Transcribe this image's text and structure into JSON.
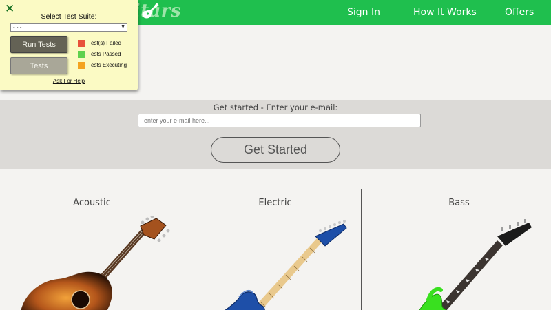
{
  "header": {
    "logo_text": "Original Guitars",
    "logo_icon": "guitar-icon",
    "nav": {
      "sign_in": "Sign In",
      "how_it_works": "How It Works",
      "offers": "Offers"
    },
    "colors": {
      "bar": "#1fbf4e",
      "logo": "#9ee4a9"
    }
  },
  "signup": {
    "label": "Get started - Enter your e-mail:",
    "email_placeholder": "enter your e-mail here...",
    "email_value": "",
    "button_label": "Get Started"
  },
  "products": [
    {
      "title": "Acoustic",
      "image": "acoustic-guitar",
      "color": "#b5551c"
    },
    {
      "title": "Electric",
      "image": "electric-guitar",
      "color": "#1e4fa8"
    },
    {
      "title": "Bass",
      "image": "bass-guitar",
      "color": "#39e01f"
    }
  ],
  "test_panel": {
    "close_icon": "close-icon",
    "suite_label": "Select Test Suite:",
    "suite_selected": "- - -",
    "run_button": "Run Tests",
    "tests_button": "Tests",
    "legend": [
      {
        "label": "Test(s) Failed",
        "color": "#e8513a"
      },
      {
        "label": "Tests Passed",
        "color": "#5fd14f"
      },
      {
        "label": "Tests Executing",
        "color": "#f4a31f"
      }
    ],
    "help_link": "Ask For Help"
  }
}
